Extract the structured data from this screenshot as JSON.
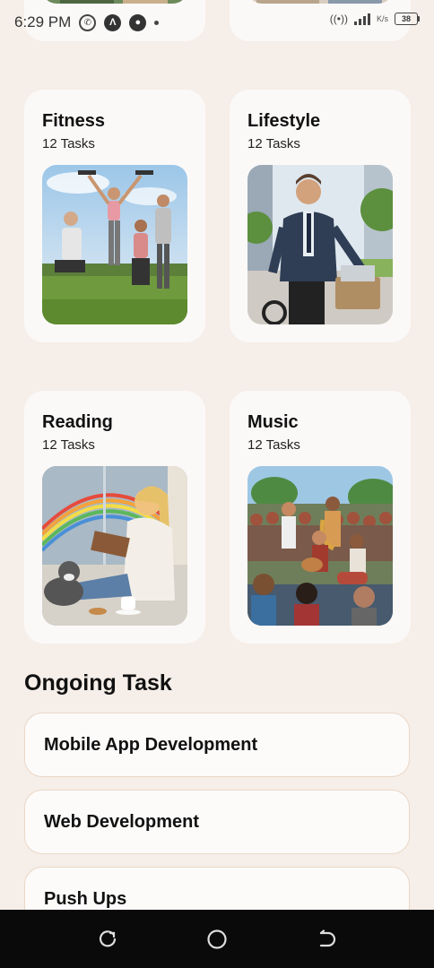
{
  "status_bar": {
    "time": "6:29 PM",
    "icons_left": [
      "whatsapp-icon",
      "app-a-icon",
      "app-drop-icon",
      "dot-icon"
    ],
    "net_speed": "K/s",
    "battery": "38"
  },
  "categories": [
    {
      "title": "Fitness",
      "subtitle": "12 Tasks",
      "image": "group-workout-illustration"
    },
    {
      "title": "Lifestyle",
      "subtitle": "12 Tasks",
      "image": "man-cycling-illustration"
    },
    {
      "title": "Reading",
      "subtitle": "12 Tasks",
      "image": "girl-reading-rainbow-illustration"
    },
    {
      "title": "Music",
      "subtitle": "12 Tasks",
      "image": "outdoor-band-illustration"
    }
  ],
  "ongoing": {
    "title": "Ongoing Task",
    "tasks": [
      {
        "label": "Mobile App Development"
      },
      {
        "label": "Web Development"
      },
      {
        "label": "Push Ups"
      }
    ]
  },
  "nav": {
    "icons": [
      "recent-apps-icon",
      "home-icon",
      "back-icon"
    ]
  },
  "colors": {
    "background": "#f6eee8",
    "card": "#fbf9f8",
    "task_border": "#ead7c6",
    "nav_bar": "#0a0a0a"
  }
}
